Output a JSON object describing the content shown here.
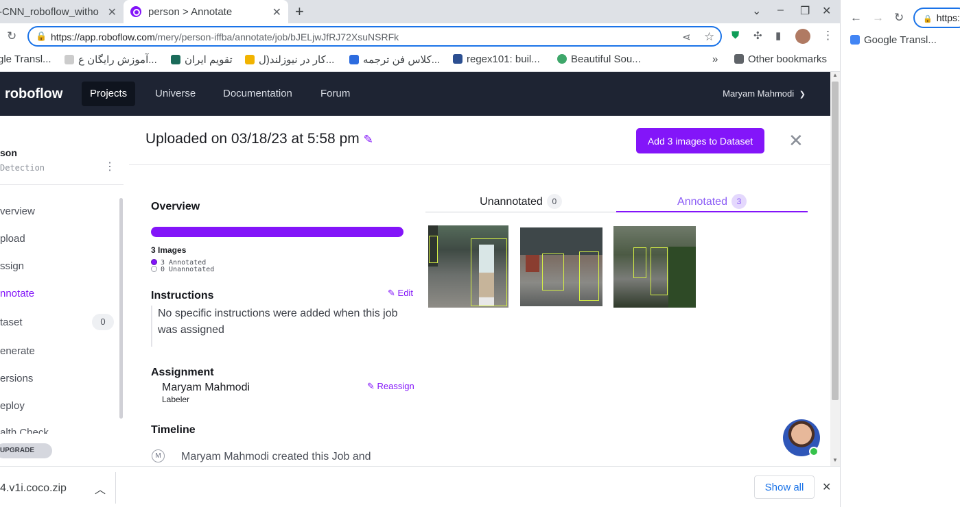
{
  "browser": {
    "tabs": [
      {
        "title": "-CNN_roboflow_witho"
      },
      {
        "title": "person > Annotate"
      }
    ],
    "new_tab_icon": "plus-icon",
    "url_host": "https://app.roboflow.com",
    "url_path": "/mery/person-iffba/annotate/job/bJELjwJfRJ72XsuNSRFk",
    "bookmarks": [
      {
        "label": "gle Transl..."
      },
      {
        "label": "آموزش رایگان ع..."
      },
      {
        "label": "تقویم ایران"
      },
      {
        "label": "کار در نیوزلند(ل..."
      },
      {
        "label": "کلاس فن ترجمه..."
      },
      {
        "label": "regex101: buil..."
      },
      {
        "label": "Beautiful Sou..."
      }
    ],
    "bookmarks_overflow": "»",
    "other_bookmarks": "Other bookmarks",
    "second_window": {
      "url_stub": "https:",
      "bookmark": "Google Transl..."
    }
  },
  "app": {
    "logo": "roboflow",
    "nav": [
      {
        "label": "Projects"
      },
      {
        "label": "Universe"
      },
      {
        "label": "Documentation"
      },
      {
        "label": "Forum"
      }
    ],
    "user_name": "Maryam Mahmodi"
  },
  "sidebar": {
    "project_name": "son",
    "project_type": "Detection",
    "items": [
      {
        "label": "verview"
      },
      {
        "label": "pload"
      },
      {
        "label": "ssign"
      },
      {
        "label": "nnotate"
      },
      {
        "label": "taset",
        "count": "0"
      },
      {
        "label": "enerate"
      },
      {
        "label": "ersions"
      },
      {
        "label": "eploy"
      },
      {
        "label": "alth Check"
      }
    ],
    "upgrade": "UPGRADE"
  },
  "job": {
    "title": "Uploaded on 03/18/23 at 5:58 pm",
    "add_button": "Add 3 images to Dataset",
    "overview_heading": "Overview",
    "progress_fraction": 1.0,
    "images_total": "3 Images",
    "annotated_line": "3 Annotated",
    "unannotated_line": "0 Unannotated",
    "instructions_heading": "Instructions",
    "edit_label": "Edit",
    "instructions_text": "No specific instructions were added when this job was assigned",
    "assignment_heading": "Assignment",
    "assignee": "Maryam Mahmodi",
    "assignee_role": "Labeler",
    "reassign_label": "Reassign",
    "timeline_heading": "Timeline",
    "timeline_initial": "M",
    "timeline_entry": "Maryam Mahmodi created this Job and"
  },
  "images_panel": {
    "tabs": [
      {
        "label": "Unannotated",
        "count": "0"
      },
      {
        "label": "Annotated",
        "count": "3"
      }
    ]
  },
  "downloads": {
    "file": "4.v1i.coco.zip",
    "show_all": "Show all"
  },
  "colors": {
    "accent": "#8315f9",
    "nav_bg": "#1e2433",
    "bbox": "#d6f045"
  }
}
